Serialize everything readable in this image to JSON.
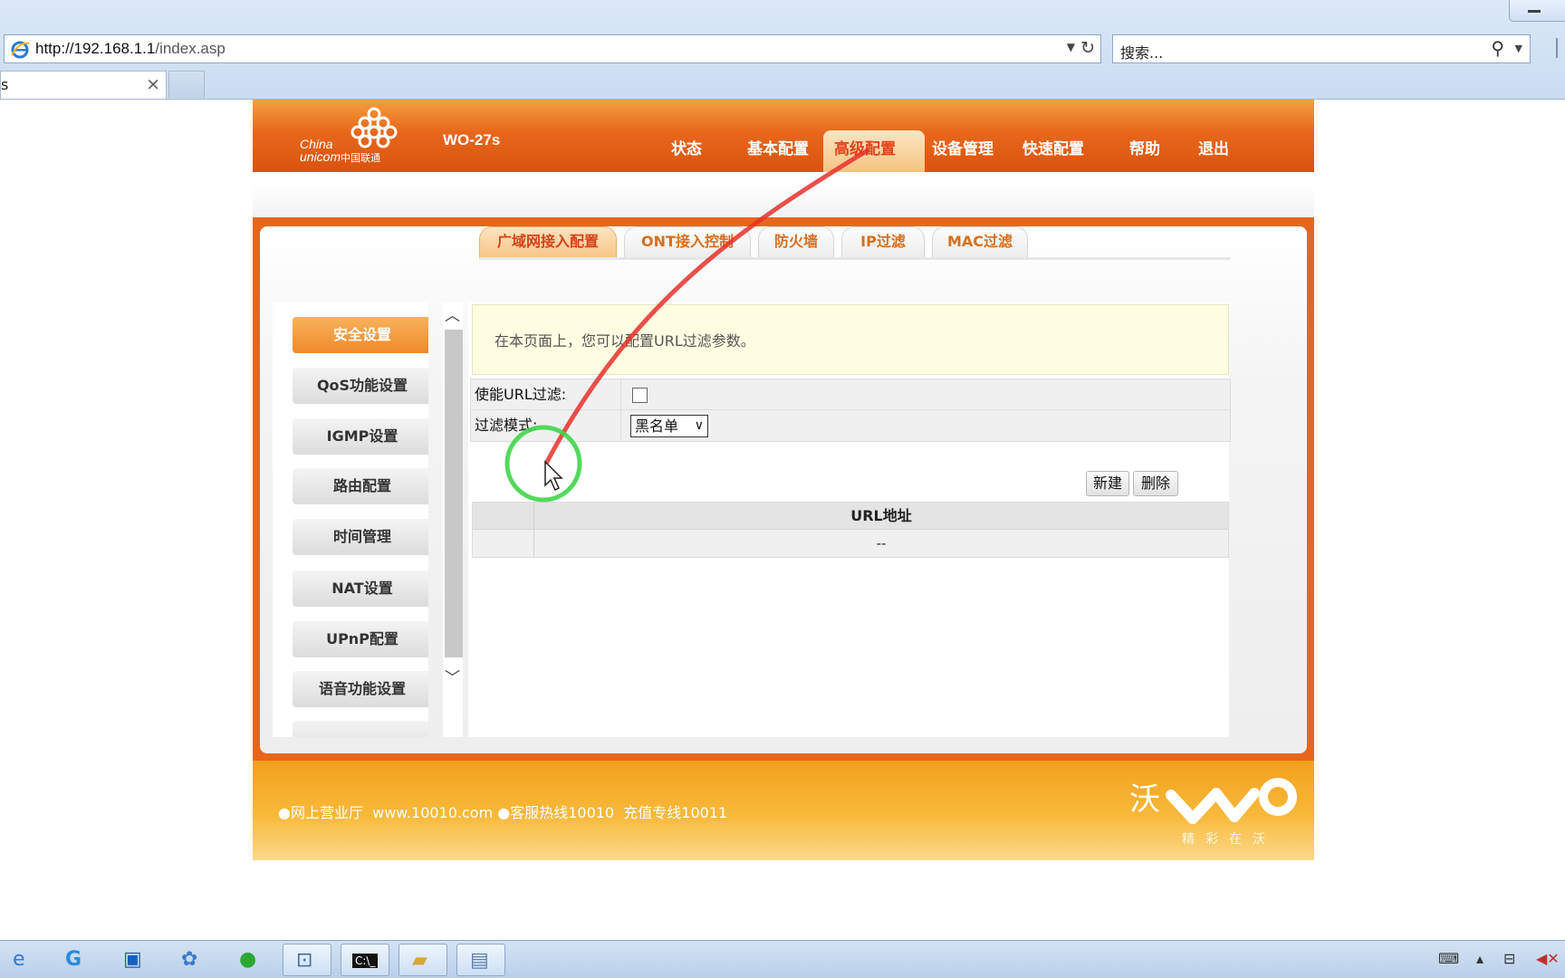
{
  "browser": {
    "url_host": "http://192.168.1.1",
    "url_path": "/index.asp",
    "search_placeholder": "搜索...",
    "tab_title": "s"
  },
  "router": {
    "brand": {
      "en": "China\nunicom",
      "cn": "中国联通"
    },
    "model": "WO-27s",
    "nav": [
      "状态",
      "基本配置",
      "高级配置",
      "设备管理",
      "快速配置",
      "帮助",
      "退出"
    ],
    "nav_active": "高级配置",
    "subtabs": [
      "广域网接入配置",
      "ONT接入控制",
      "防火墙",
      "IP过滤",
      "MAC过滤"
    ],
    "menu": [
      "安全设置",
      "QoS功能设置",
      "IGMP设置",
      "路由配置",
      "时间管理",
      "NAT设置",
      "UPnP配置",
      "语音功能设置"
    ],
    "info_text": "在本页面上，您可以配置URL过滤参数。",
    "form": {
      "enable_label": "使能URL过滤:",
      "mode_label": "过滤模式:",
      "mode_value": "黑名单"
    },
    "buttons": {
      "new": "新建",
      "delete": "删除"
    },
    "table": {
      "header": "URL地址",
      "empty": "--"
    },
    "footer": {
      "text": "●网上营业厅  www.10010.com ●客服热线10010  充值专线10011",
      "logo": "沃",
      "slogan": "精彩在沃"
    }
  },
  "colors": {
    "header_orange": "#e8671c",
    "footer_orange": "#f3a01d",
    "annotation_red": "#e8302a",
    "annotation_green": "#3fd64a"
  },
  "taskbar": {
    "icons": [
      "ie-icon",
      "g-icon",
      "media-icon",
      "network-icon",
      "wechat-icon",
      "remote-desktop-icon",
      "cmd-icon",
      "folder-icon",
      "notepad-icon"
    ],
    "cmd_label": "C:\\_"
  }
}
